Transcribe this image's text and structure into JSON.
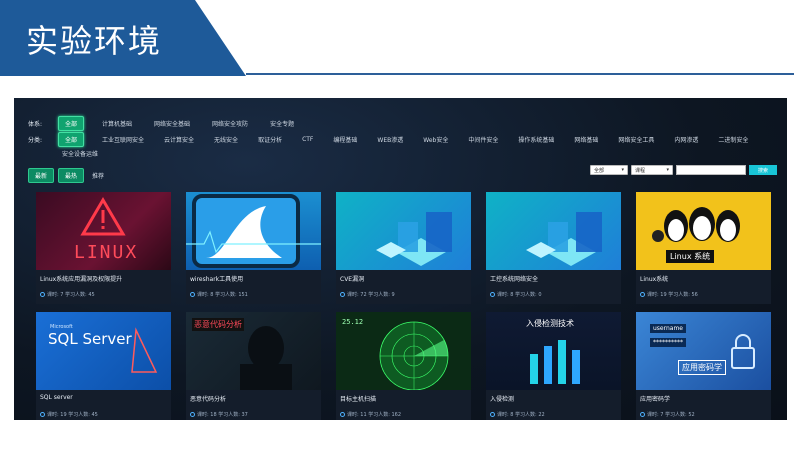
{
  "slide": {
    "title": "实验环境"
  },
  "filters": {
    "system_label": "体系:",
    "system_items": [
      "全部",
      "计算机基础",
      "网络安全基础",
      "网络安全攻防",
      "安全专题"
    ],
    "category_label": "分类:",
    "category_items": [
      "全部",
      "工业互联网安全",
      "云计算安全",
      "无线安全",
      "取证分析",
      "CTF",
      "编程基础",
      "WEB渗透",
      "Web安全",
      "中间件安全",
      "操作系统基础",
      "网络基础",
      "网络安全工具",
      "内网渗透",
      "二进制安全",
      "安全设备运维"
    ]
  },
  "sort": {
    "latest": "最新",
    "hot": "最热",
    "recommend": "推荐"
  },
  "search": {
    "select1": "全部",
    "select2": "课程",
    "placeholder": "",
    "button": "搜索"
  },
  "cards": [
    {
      "title": "Linux系统应用漏洞及权限提升",
      "meta": "课时: 7 学习人数: 45",
      "thumb_text": "LINUX"
    },
    {
      "title": "wireshark工具使用",
      "meta": "课时: 8 学习人数: 151"
    },
    {
      "title": "CVE漏洞",
      "meta": "课时: 72 学习人数: 9"
    },
    {
      "title": "工控系统网络安全",
      "meta": "课时: 8 学习人数: 0"
    },
    {
      "title": "Linux系统",
      "meta": "课时: 19 学习人数: 56",
      "thumb_text": "Linux 系统"
    },
    {
      "title": "SQL server",
      "meta": "课时: 19 学习人数: 45",
      "thumb_text": "SQL Server",
      "thumb_sub": "Microsoft"
    },
    {
      "title": "恶意代码分析",
      "meta": "课时: 18 学习人数: 37",
      "thumb_text": "恶意代码分析"
    },
    {
      "title": "目标主机扫描",
      "meta": "课时: 11 学习人数: 162",
      "thumb_text": "25.12"
    },
    {
      "title": "入侵检测",
      "meta": "课时: 8 学习人数: 22",
      "thumb_text": "入侵检测技术"
    },
    {
      "title": "应用密码学",
      "meta": "课时: 7 学习人数: 52",
      "thumb_text": "应用密码学",
      "thumb_user": "username",
      "thumb_pass": "**********"
    }
  ]
}
